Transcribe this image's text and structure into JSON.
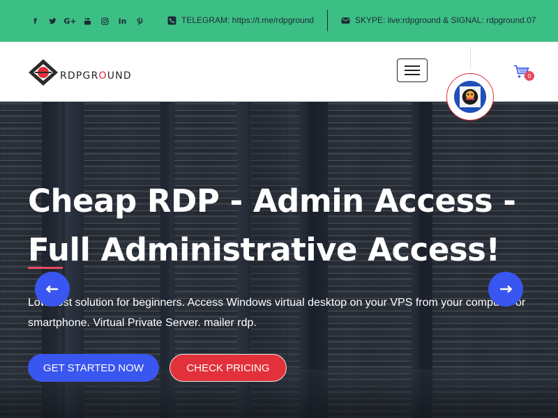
{
  "topbar": {
    "socials": [
      {
        "name": "facebook-icon",
        "glyph": "f"
      },
      {
        "name": "twitter-icon",
        "glyph": "twitter"
      },
      {
        "name": "google-plus-icon",
        "glyph": "G+"
      },
      {
        "name": "youtube-icon",
        "glyph": "youtube"
      },
      {
        "name": "instagram-icon",
        "glyph": "instagram"
      },
      {
        "name": "linkedin-icon",
        "glyph": "in"
      },
      {
        "name": "pinterest-icon",
        "glyph": "P"
      }
    ],
    "telegram_text": "TELEGRAM: https://t.me/rdpground",
    "skype_text": "SKYPE: live:rdpground & SIGNAL: rdpground.07",
    "background_color": "#3cbf85"
  },
  "header": {
    "logo_text_prefix": "RDPGR",
    "logo_text_o": "O",
    "logo_text_suffix": "UND",
    "cart_count": "0"
  },
  "hero": {
    "title": "Cheap RDP - Admin Access - Full Administrative Access!",
    "description": "Low cost solution for beginners. Access Windows virtual desktop on your VPS from your computer or smartphone. Virtual Private Server. mailer rdp.",
    "primary_button": "GET STARTED NOW",
    "secondary_button": "CHECK PRICING",
    "primary_color": "#3a56f0",
    "secondary_color": "#e2313a",
    "accent_color": "#e84a5f"
  }
}
